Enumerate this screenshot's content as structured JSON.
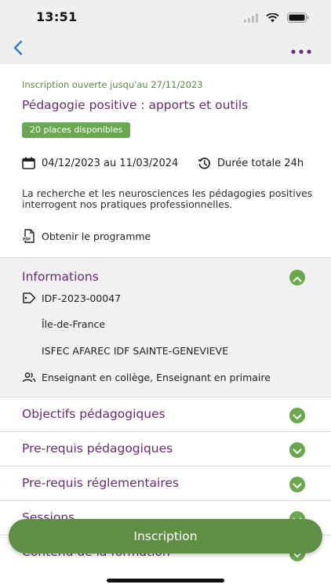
{
  "status_bar": {
    "time": "13:51"
  },
  "nav": {
    "back_icon": "chevron-left-icon",
    "more_icon": "ellipsis-icon",
    "accent": "#2f7bd8"
  },
  "training": {
    "open_until": "Inscription ouverte jusqu'au 27/11/2023",
    "title": "Pédagogie positive : apports et outils",
    "places": "20 places disponibles",
    "dates": "04/12/2023 au 11/03/2024",
    "duration": "Durée totale 24h",
    "description": "La recherche et les neurosciences les pédagogies positives interrogent nos pratiques professionnelles.",
    "program_link": "Obtenir le programme"
  },
  "informations": {
    "heading": "Informations",
    "reference": "IDF-2023-00047",
    "region": "Île-de-France",
    "organization": "ISFEC AFAREC IDF SAINTE-GENEVIEVE",
    "audience": "Enseignant en collège, Enseignant en primaire"
  },
  "accordion": [
    {
      "label": "Objectifs pédagogiques"
    },
    {
      "label": "Pre-requis pédagogiques"
    },
    {
      "label": "Pre-requis réglementaires"
    },
    {
      "label": "Sessions"
    },
    {
      "label": "Contenu de la formation"
    }
  ],
  "cta": {
    "label": "Inscription"
  },
  "colors": {
    "purple": "#6b2a73",
    "green": "#6aa84f",
    "button_green": "#5f8f45"
  }
}
